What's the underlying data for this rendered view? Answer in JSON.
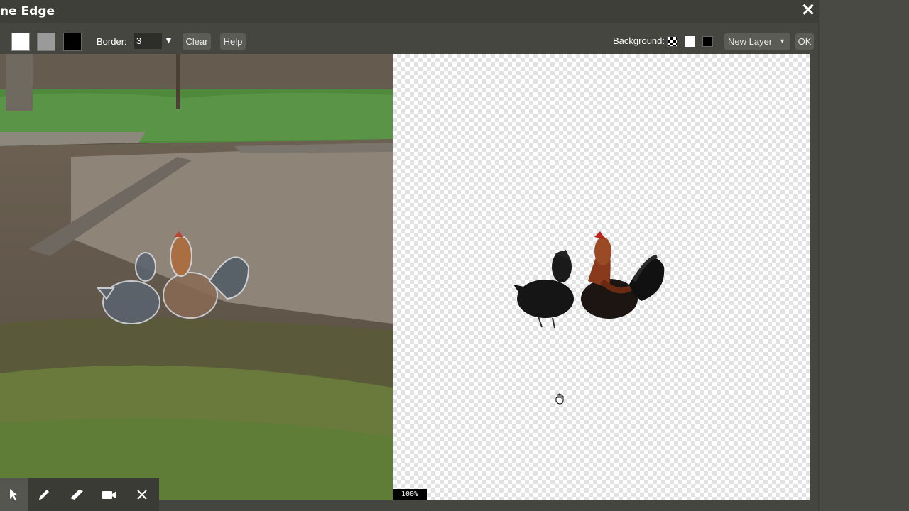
{
  "window": {
    "title": "ne Edge",
    "close_label": "✕"
  },
  "toolbar": {
    "border_label": "Border:",
    "border_value": "3",
    "border_dropdown_label": "▼",
    "clear_label": "Clear",
    "help_label": "Help",
    "background_label": "Background:",
    "layer_select_value": "New Layer",
    "layer_select_caret": "▼",
    "ok_label": "OK"
  },
  "preview": {
    "zoom": "100%"
  },
  "colors": {
    "accent": "#45463f",
    "titlebar": "#3e3f39",
    "button": "#5b5c56"
  },
  "icons": {
    "tools": [
      "pointer-icon",
      "pencil-icon",
      "eraser-icon",
      "camera-icon",
      "close-icon"
    ],
    "cursor": "hand-icon"
  }
}
